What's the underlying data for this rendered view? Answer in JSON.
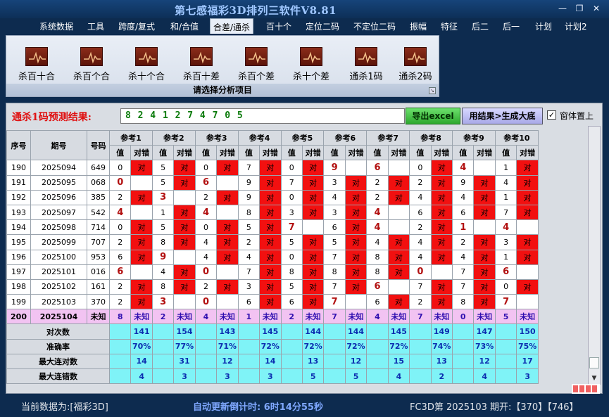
{
  "window": {
    "title": "第七感福彩3D排列三软件V8.81",
    "minimize": "—",
    "restore": "❐",
    "close": "✕"
  },
  "menu": [
    "系统数据",
    "工具",
    "跨度/复式",
    "和/合值",
    "合差/通杀",
    "百十个",
    "定位二码",
    "不定位二码",
    "振幅",
    "特征",
    "后二",
    "后一",
    "计划",
    "计划2"
  ],
  "menu_active_index": 4,
  "ribbon": {
    "buttons": [
      "杀百十合",
      "杀百个合",
      "杀十个合",
      "杀百十差",
      "杀百个差",
      "杀十个差",
      "通杀1码",
      "通杀2码"
    ],
    "footer": "请选择分析项目",
    "launcher": "↘"
  },
  "prediction": {
    "label": "通杀1码预测结果:",
    "value": "8 2 4 1 2 7 4 7 0 5",
    "excel_button": "导出excel",
    "generate_button": "用结果>生成大底",
    "checkbox_checked": true,
    "checkbox_label": "窗体置上"
  },
  "grid": {
    "headers": {
      "seq": "序号",
      "issue": "期号",
      "number": "号码"
    },
    "refs": [
      "参考1",
      "参考2",
      "参考3",
      "参考4",
      "参考5",
      "参考6",
      "参考7",
      "参考8",
      "参考9",
      "参考10"
    ],
    "subheaders": {
      "value": "值",
      "result": "对错"
    },
    "hit_text": "对",
    "rows": [
      {
        "seq": "190",
        "issue": "2025094",
        "num": "649",
        "v": [
          "0",
          "5",
          "0",
          "7",
          "0",
          "9",
          "6",
          "0",
          "4",
          "1"
        ],
        "r": [
          "对",
          "对",
          "对",
          "对",
          "对",
          "",
          "",
          "对",
          "",
          "对"
        ]
      },
      {
        "seq": "191",
        "issue": "2025095",
        "num": "068",
        "v": [
          "0",
          "5",
          "6",
          "9",
          "7",
          "3",
          "2",
          "2",
          "9",
          "4"
        ],
        "r": [
          "",
          "对",
          "",
          "对",
          "对",
          "对",
          "对",
          "对",
          "对",
          "对"
        ]
      },
      {
        "seq": "192",
        "issue": "2025096",
        "num": "385",
        "v": [
          "2",
          "3",
          "2",
          "9",
          "0",
          "4",
          "2",
          "4",
          "4",
          "1"
        ],
        "r": [
          "对",
          "",
          "对",
          "对",
          "对",
          "对",
          "对",
          "对",
          "对",
          "对"
        ]
      },
      {
        "seq": "193",
        "issue": "2025097",
        "num": "542",
        "v": [
          "4",
          "1",
          "4",
          "8",
          "3",
          "3",
          "4",
          "6",
          "6",
          "7"
        ],
        "r": [
          "",
          "对",
          "",
          "对",
          "对",
          "对",
          "",
          "对",
          "对",
          "对"
        ]
      },
      {
        "seq": "194",
        "issue": "2025098",
        "num": "714",
        "v": [
          "0",
          "5",
          "0",
          "5",
          "7",
          "6",
          "4",
          "2",
          "1",
          "4"
        ],
        "r": [
          "对",
          "对",
          "对",
          "对",
          "",
          "对",
          "",
          "对",
          "",
          ""
        ]
      },
      {
        "seq": "195",
        "issue": "2025099",
        "num": "707",
        "v": [
          "2",
          "8",
          "4",
          "2",
          "5",
          "5",
          "4",
          "4",
          "2",
          "3"
        ],
        "r": [
          "对",
          "对",
          "对",
          "对",
          "对",
          "对",
          "对",
          "对",
          "对",
          "对"
        ]
      },
      {
        "seq": "196",
        "issue": "2025100",
        "num": "953",
        "v": [
          "6",
          "9",
          "4",
          "4",
          "0",
          "7",
          "8",
          "4",
          "4",
          "1"
        ],
        "r": [
          "对",
          "",
          "对",
          "对",
          "对",
          "对",
          "对",
          "对",
          "对",
          "对"
        ]
      },
      {
        "seq": "197",
        "issue": "2025101",
        "num": "016",
        "v": [
          "6",
          "4",
          "0",
          "7",
          "8",
          "8",
          "8",
          "0",
          "7",
          "6"
        ],
        "r": [
          "",
          "对",
          "",
          "对",
          "对",
          "对",
          "对",
          "",
          "对",
          ""
        ]
      },
      {
        "seq": "198",
        "issue": "2025102",
        "num": "161",
        "v": [
          "2",
          "8",
          "2",
          "3",
          "5",
          "7",
          "6",
          "7",
          "7",
          "0"
        ],
        "r": [
          "对",
          "对",
          "对",
          "对",
          "对",
          "对",
          "",
          "对",
          "对",
          "对"
        ]
      },
      {
        "seq": "199",
        "issue": "2025103",
        "num": "370",
        "v": [
          "2",
          "3",
          "0",
          "6",
          "6",
          "7",
          "6",
          "2",
          "8",
          "7"
        ],
        "r": [
          "对",
          "",
          "",
          "对",
          "对",
          "",
          "对",
          "对",
          "对",
          ""
        ]
      }
    ],
    "pred_row": {
      "seq": "200",
      "issue": "2025104",
      "num": "未知",
      "v": [
        "8",
        "2",
        "4",
        "1",
        "2",
        "7",
        "4",
        "7",
        "0",
        "5"
      ],
      "r": [
        "未知",
        "未知",
        "未知",
        "未知",
        "未知",
        "未知",
        "未知",
        "未知",
        "未知",
        "未知"
      ]
    },
    "stats": [
      {
        "label": "对次数",
        "values": [
          "141",
          "154",
          "143",
          "145",
          "144",
          "144",
          "145",
          "149",
          "147",
          "150"
        ]
      },
      {
        "label": "准确率",
        "values": [
          "70%",
          "77%",
          "71%",
          "72%",
          "72%",
          "72%",
          "72%",
          "74%",
          "73%",
          "75%"
        ]
      },
      {
        "label": "最大连对数",
        "values": [
          "14",
          "31",
          "12",
          "14",
          "13",
          "12",
          "15",
          "13",
          "12",
          "17"
        ]
      },
      {
        "label": "最大连错数",
        "values": [
          "4",
          "3",
          "3",
          "3",
          "5",
          "5",
          "4",
          "2",
          "4",
          "3"
        ]
      }
    ]
  },
  "status": {
    "current": "当前数据为:[福彩3D]",
    "countdown": "自动更新倒计时: 6时14分55秒",
    "issue": "FC3D第 2025103 期开:【370】【746】"
  },
  "colors": {
    "hit": "#f21010",
    "pred_row": "#f2c3f2",
    "stats_row": "#7ff3f7",
    "window_bg": "#0d2b4f"
  }
}
